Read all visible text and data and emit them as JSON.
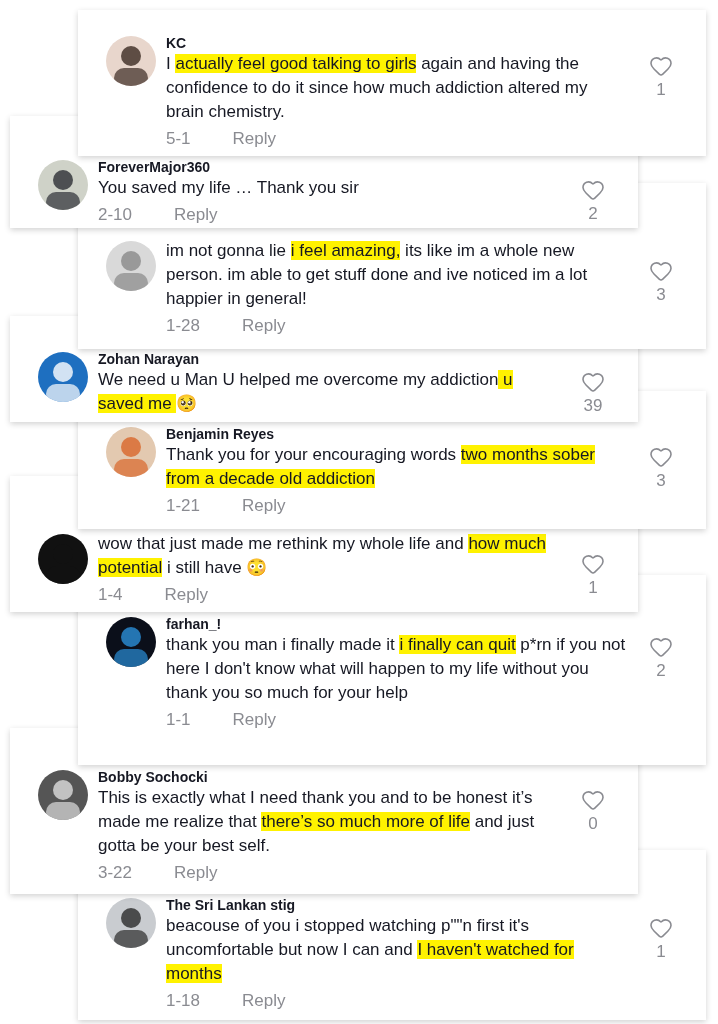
{
  "comments": [
    {
      "username": "KC",
      "segments": [
        {
          "text": "I ",
          "highlighted": false
        },
        {
          "text": "actually feel good talking to girls",
          "highlighted": true
        },
        {
          "text": " again and having the confidence to do it since how much addiction altered my brain chemistry.",
          "highlighted": false
        }
      ],
      "likes": "1",
      "date": "5-1",
      "reply": "Reply"
    },
    {
      "username": "ForeverMajor360",
      "segments": [
        {
          "text": "You saved my life … Thank you sir",
          "highlighted": false
        }
      ],
      "likes": "2",
      "date": "2-10",
      "reply": "Reply"
    },
    {
      "segments": [
        {
          "text": "im not gonna lie ",
          "highlighted": false
        },
        {
          "text": "i feel amazing,",
          "highlighted": true
        },
        {
          "text": " its like im a whole new person. im able to get stuff done and ive noticed im a lot happier in general!",
          "highlighted": false
        }
      ],
      "likes": "3",
      "date": "1-28",
      "reply": "Reply"
    },
    {
      "username": "Zohan Narayan",
      "segments": [
        {
          "text": "We need u Man U helped me overcome my addiction",
          "highlighted": false
        },
        {
          "text": " u saved me ",
          "highlighted": true
        },
        {
          "text": "🥺",
          "highlighted": false
        }
      ],
      "likes": "39"
    },
    {
      "username": "Benjamin Reyes",
      "segments": [
        {
          "text": "Thank you for your encouraging words ",
          "highlighted": false
        },
        {
          "text": "two months sober from a decade old addiction",
          "highlighted": true
        }
      ],
      "likes": "3",
      "date": "1-21",
      "reply": "Reply"
    },
    {
      "segments": [
        {
          "text": "wow that just made me rethink my whole life and ",
          "highlighted": false
        },
        {
          "text": "how much potential",
          "highlighted": true
        },
        {
          "text": " i still have 😳",
          "highlighted": false
        }
      ],
      "likes": "1",
      "date": "1-4",
      "reply": "Reply"
    },
    {
      "username": "farhan_!",
      "segments": [
        {
          "text": "thank you man i finally made it ",
          "highlighted": false
        },
        {
          "text": "i finally can quit",
          "highlighted": true
        },
        {
          "text": " p*rn if you not here I don't know what will happen to my life without you thank you so much for your help",
          "highlighted": false
        }
      ],
      "likes": "2",
      "date": "1-1",
      "reply": "Reply"
    },
    {
      "username": "Bobby Sochocki",
      "segments": [
        {
          "text": "This is exactly what I need thank you and to be honest it’s made me realize that ",
          "highlighted": false
        },
        {
          "text": "there’s so much more of life",
          "highlighted": true
        },
        {
          "text": " and just gotta be your best self.",
          "highlighted": false
        }
      ],
      "likes": "0",
      "date": "3-22",
      "reply": "Reply"
    },
    {
      "username": "The Sri Lankan stig",
      "segments": [
        {
          "text": "beacouse of you i stopped watching p\"\"n first it's uncomfortable but now I can and ",
          "highlighted": false
        },
        {
          "text": "I haven't watched for months",
          "highlighted": true
        }
      ],
      "likes": "1",
      "date": "1-18",
      "reply": "Reply"
    }
  ]
}
